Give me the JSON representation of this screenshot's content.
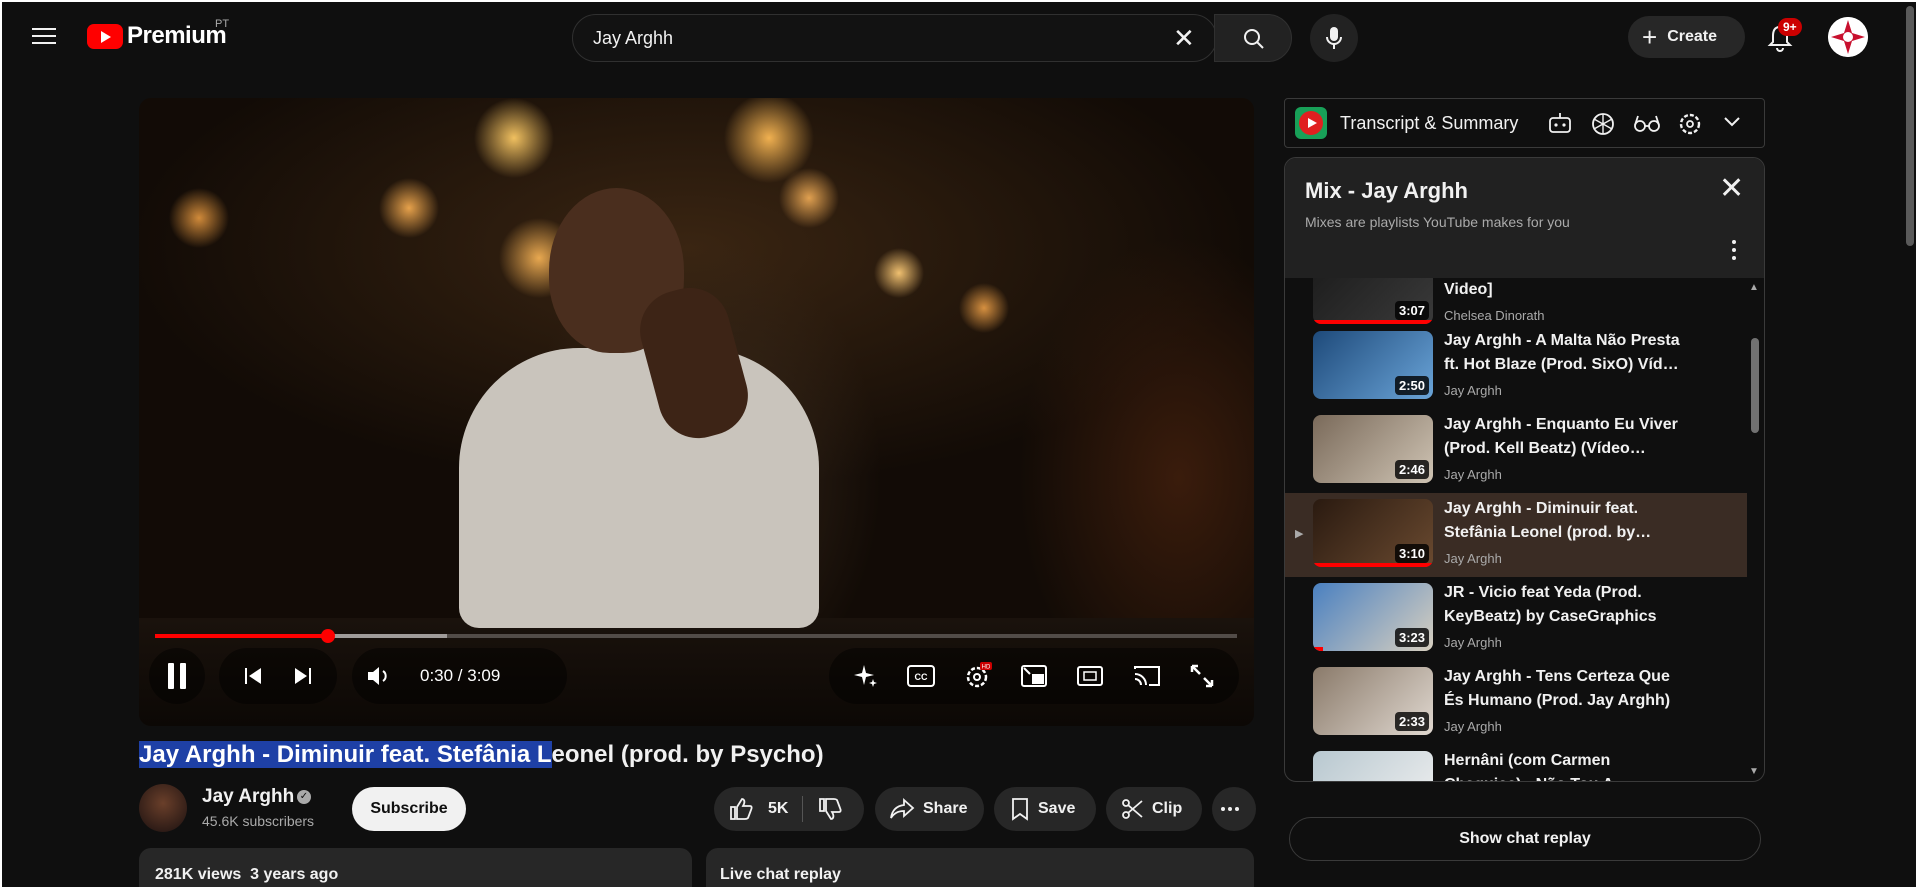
{
  "header": {
    "logo_text": "Premium",
    "country": "PT",
    "search_value": "Jay Arghh",
    "create_label": "Create",
    "notif_count": "9+"
  },
  "player": {
    "time": "0:30 / 3:09",
    "progress": 0.16,
    "buffered": 0.27
  },
  "video": {
    "title_selected": "Jay Arghh - Diminuir feat. Stefânia L",
    "title_rest": "eonel (prod. by Psycho)",
    "channel": "Jay Arghh",
    "subscribers": "45.6K subscribers",
    "subscribe_label": "Subscribe",
    "likes": "5K",
    "share_label": "Share",
    "save_label": "Save",
    "clip_label": "Clip",
    "views": "281K views",
    "age": "3 years ago",
    "live_chat_label": "Live chat replay"
  },
  "transcript": {
    "title": "Transcript & Summary"
  },
  "mix": {
    "title": "Mix - Jay Arghh",
    "subtitle": "Mixes are playlists YouTube makes for you",
    "items": [
      {
        "title": "(@AndersonMario) [Lyric Video]",
        "channel": "Chelsea Dinorath",
        "duration": "3:07",
        "watched": 1.0,
        "active": false
      },
      {
        "title": "Jay Arghh - A Malta Não Presta ft. Hot Blaze (Prod. SixO) Víd…",
        "channel": "Jay Arghh",
        "duration": "2:50",
        "watched": 0,
        "active": false
      },
      {
        "title": "Jay Arghh - Enquanto Eu Viver (Prod. Kell Beatz) (Vídeo…",
        "channel": "Jay Arghh",
        "duration": "2:46",
        "watched": 0,
        "active": false
      },
      {
        "title": "Jay Arghh - Diminuir feat. Stefânia Leonel (prod. by…",
        "channel": "Jay Arghh",
        "duration": "3:10",
        "watched": 1.0,
        "active": true
      },
      {
        "title": "JR - Vicio feat Yeda (Prod. KeyBeatz) by CaseGraphics",
        "channel": "Jay Arghh",
        "duration": "3:23",
        "watched": 0.08,
        "active": false
      },
      {
        "title": "Jay Arghh - Tens Certeza Que És Humano (Prod. Jay Arghh)",
        "channel": "Jay Arghh",
        "duration": "2:33",
        "watched": 0,
        "active": false
      },
      {
        "title": "Hernâni (com Carmen Chaquice) - Não Tou A…",
        "channel": "",
        "duration": "",
        "watched": 0,
        "active": false
      }
    ]
  },
  "show_chat_label": "Show chat replay",
  "colors": {
    "accent": "#ff0000",
    "bg": "#0f0f0f",
    "selection": "#1e40a6"
  }
}
